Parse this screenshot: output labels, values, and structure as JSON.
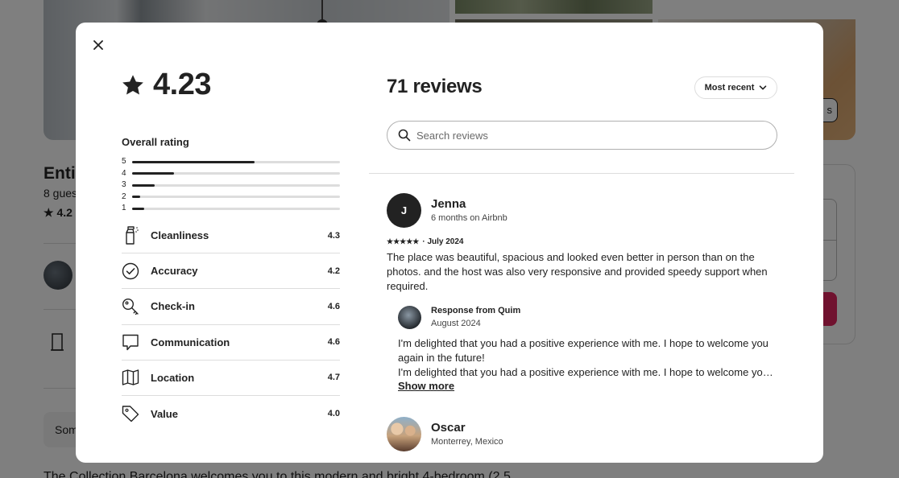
{
  "background": {
    "listing_title": "Entir",
    "guests_text": "8 gues",
    "rating_text": "★ 4.2",
    "show_all_label": "s",
    "some_label": "Som",
    "description_text": "The Collection Barcelona welcomes you to this modern and bright 4-bedroom (2.5"
  },
  "modal": {
    "close_icon": "close-icon",
    "rating": {
      "icon": "star-icon",
      "value": "4.23"
    },
    "overall": {
      "label": "Overall rating",
      "distribution": [
        {
          "stars": "5",
          "fraction": 0.59
        },
        {
          "stars": "4",
          "fraction": 0.2
        },
        {
          "stars": "3",
          "fraction": 0.11
        },
        {
          "stars": "2",
          "fraction": 0.04
        },
        {
          "stars": "1",
          "fraction": 0.06
        }
      ]
    },
    "categories": [
      {
        "icon": "spray-bottle-icon",
        "label": "Cleanliness",
        "value": "4.3"
      },
      {
        "icon": "check-circle-icon",
        "label": "Accuracy",
        "value": "4.2"
      },
      {
        "icon": "key-icon",
        "label": "Check-in",
        "value": "4.6"
      },
      {
        "icon": "chat-bubble-icon",
        "label": "Communication",
        "value": "4.6"
      },
      {
        "icon": "map-icon",
        "label": "Location",
        "value": "4.7"
      },
      {
        "icon": "tag-icon",
        "label": "Value",
        "value": "4.0"
      }
    ],
    "reviews_header": {
      "count_label": "71 reviews",
      "sort_label": "Most recent",
      "sort_icon": "chevron-down-icon"
    },
    "search": {
      "icon": "search-icon",
      "placeholder": "Search reviews",
      "value": ""
    },
    "reviews": [
      {
        "avatar_initial": "J",
        "name": "Jenna",
        "subtitle": "6 months on Airbnb",
        "stars": "★★★★★",
        "date": "· July 2024",
        "text": "The place was beautiful, spacious and looked even better in person than on the photos. and the host was also very responsive and provided speedy support when required.",
        "response": {
          "title": "Response from Quim",
          "date": "August 2024",
          "line1": "I'm delighted that you had a positive experience with me. I hope to welcome you again in the future!",
          "line2": "I'm delighted that you had a positive experience with me. I hope to welcome you again in the future!",
          "show_more": "Show more"
        }
      },
      {
        "name": "Oscar",
        "subtitle": "Monterrey, Mexico"
      }
    ]
  }
}
